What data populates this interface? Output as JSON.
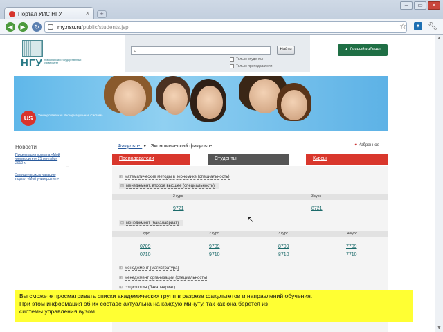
{
  "browser": {
    "tab_title": "Портал УИС НГУ",
    "tab_close": "×",
    "new_tab": "+",
    "window_buttons": [
      "–",
      "▭",
      "×"
    ],
    "url_host": "my.nsu.ru",
    "url_path": "/public/students.jsp",
    "icons": [
      "back-icon",
      "forward-icon",
      "reload-icon",
      "star-icon",
      "extension-icon",
      "wrench-icon"
    ]
  },
  "site": {
    "logo_text": "НГУ",
    "logo_subtitle": "новосибирский государственный университет",
    "search_button": "Найти",
    "checkbox_students": "Только студенты",
    "checkbox_teachers": "Только преподаватели",
    "cabinet_button": "Личный кабинет",
    "us_logo": "US",
    "us_text": "Университетская Информационная Система"
  },
  "news": {
    "title": "Новости",
    "items": [
      {
        "text": "Презентация портала «Мой университет» 21 сентября 2010 г.",
        "date": "..."
      },
      {
        "text": "Запущен в эксплуатацию портал «Мой университет»",
        "date": "..."
      }
    ]
  },
  "main": {
    "breadcrumb_link": "Факультет",
    "breadcrumb_current": "Экономический факультет",
    "favorite": "Избранное",
    "tabs": [
      "Преподаватели",
      "Студенты",
      "Курсы"
    ],
    "specialties": [
      "математические методы в экономике (специальность)",
      "менеджмент, второе высшее (специальность)",
      "менеджмент (бакалавриат)",
      "менеджмент (магистратура)",
      "менеджмент организации (специальность)",
      "социология (бакалавриат)"
    ],
    "block1": {
      "courses": [
        "2 курс",
        "3 курс"
      ],
      "groups": [
        "9721",
        "8721"
      ]
    },
    "block2": {
      "courses": [
        "1 курс",
        "2 курс",
        "3 курс",
        "4 курс"
      ],
      "groups": [
        [
          "0709",
          "0710"
        ],
        [
          "9709",
          "9710"
        ],
        [
          "8709",
          "8710"
        ],
        [
          "7709",
          "7710"
        ]
      ]
    }
  },
  "caption": {
    "line1": "Вы сможете просматривать списки академических групп в разрезе факультетов и направлений обучения.",
    "line2": "При этом информация об их составе актуальна на каждую минуту, так как она берется из",
    "line3": "системы управления вузом."
  }
}
